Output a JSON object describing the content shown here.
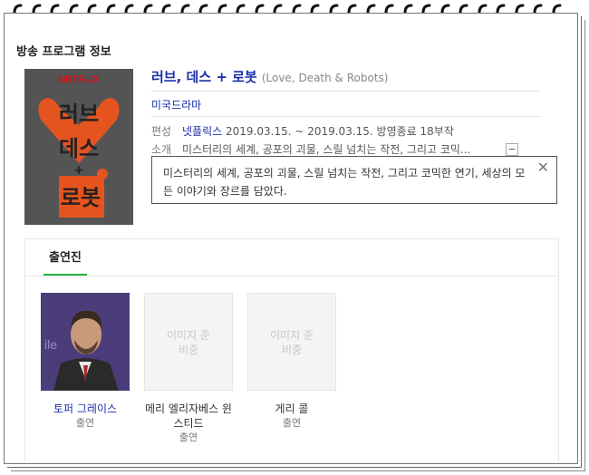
{
  "section_title": "방송 프로그램 정보",
  "poster": {
    "brand": "NETFLIX",
    "title_lines": [
      "러브",
      "데스",
      "+",
      "로봇"
    ],
    "accent": "#e5541f"
  },
  "program": {
    "title": "러브, 데스 + 로봇",
    "title_original": "(Love, Death & Robots)",
    "genre": "미국드라마",
    "meta": [
      {
        "key": "편성",
        "link": "넷플릭스",
        "value": "2019.03.15. ~ 2019.03.15. 방영종료 18부작"
      },
      {
        "key": "소개",
        "link": "",
        "value": "미스터리의 세계, 공포의 괴물, 스릴 넘치는 작전, 그리고 코믹..."
      }
    ],
    "expand_label": "−"
  },
  "tooltip": {
    "text": "미스터리의 세계, 공포의 괴물, 스릴 넘치는 작전, 그리고 코믹한 연기, 세상의 모든 이야기와 장르를 담았다.",
    "close_label": "✕"
  },
  "cast": {
    "tab_label": "출연진",
    "members": [
      {
        "name": "토퍼 그레이스",
        "role": "출연",
        "photo": "person-photo",
        "placeholder": ""
      },
      {
        "name": "메리 엘리자베스 윈스티드",
        "role": "출연",
        "photo": "placeholder",
        "placeholder": "이미지 준비중"
      },
      {
        "name": "게리 콜",
        "role": "출연",
        "photo": "placeholder",
        "placeholder": "이미지 준비중"
      }
    ]
  },
  "colors": {
    "link": "#1a2eaa",
    "tab_underline": "#23b33a",
    "poster_accent": "#e5541f"
  }
}
